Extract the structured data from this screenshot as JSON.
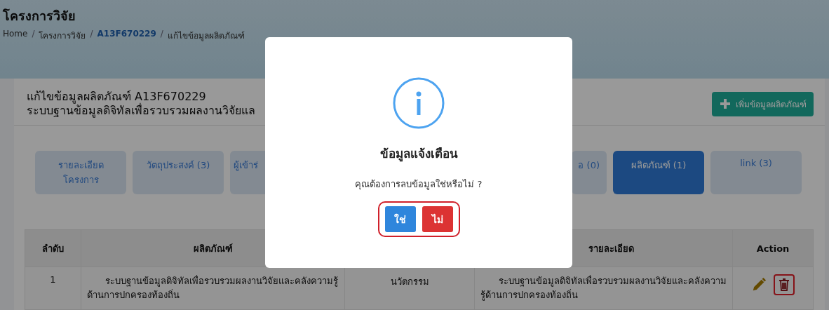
{
  "page": {
    "title": "โครงการวิจัย"
  },
  "breadcrumb_separator": "/",
  "breadcrumb": [
    {
      "label": "Home",
      "link": false
    },
    {
      "label": "โครงการวิจัย",
      "link": false
    },
    {
      "label": "A13F670229",
      "link": true
    },
    {
      "label": "แก้ไขข้อมูลผลิตภัณฑ์",
      "link": false
    }
  ],
  "card": {
    "title": "แก้ไขข้อมูลผลิตภัณฑ์ A13F670229",
    "subtitle": "ระบบฐานข้อมูลดิจิทัลเพื่อรวบรวมผลงานวิจัยแล",
    "add_button": "เพิ่มข้อมูลผลิตภัณฑ์"
  },
  "tabs": [
    {
      "label": "รายละเอียด\nโครงการ",
      "selected": false,
      "kind": "whole"
    },
    {
      "label": "วัตถุประสงค์ (3)",
      "selected": false,
      "kind": "whole"
    },
    {
      "label": "ผู้เข้าร่",
      "selected": false,
      "kind": "cut_end"
    },
    {
      "label": "อ (0)",
      "selected": false,
      "kind": "cut_start"
    },
    {
      "label": "ผลิตภัณฑ์ (1)",
      "selected": true,
      "kind": "whole"
    },
    {
      "label": "link (3)",
      "selected": false,
      "kind": "whole"
    }
  ],
  "table": {
    "columns": [
      "ลำดับ",
      "ผลิตภัณฑ์",
      "รายละเอียด",
      "Action"
    ],
    "rows": [
      {
        "index": "1",
        "product": "ระบบฐานข้อมูลดิจิทัลเพื่อรวบรวมผลงานวิจัยและคลังความรู้ด้านการปกครองท้องถิ่น",
        "column_3": "นวัตกรรม",
        "details": "ระบบฐานข้อมูลดิจิทัลเพื่อรวบรวมผลงานวิจัยและคลังความรู้ด้านการปกครองท้องถิ่น",
        "delete_highlighted": true
      }
    ]
  },
  "dialog": {
    "title": "ข้อมูลแจ้งเตือน",
    "message": "คุณต้องการลบข้อมูลใช่หรือไม่ ?",
    "confirm": "ใช่",
    "cancel": "ไม่",
    "buttons_highlighted": true
  }
}
